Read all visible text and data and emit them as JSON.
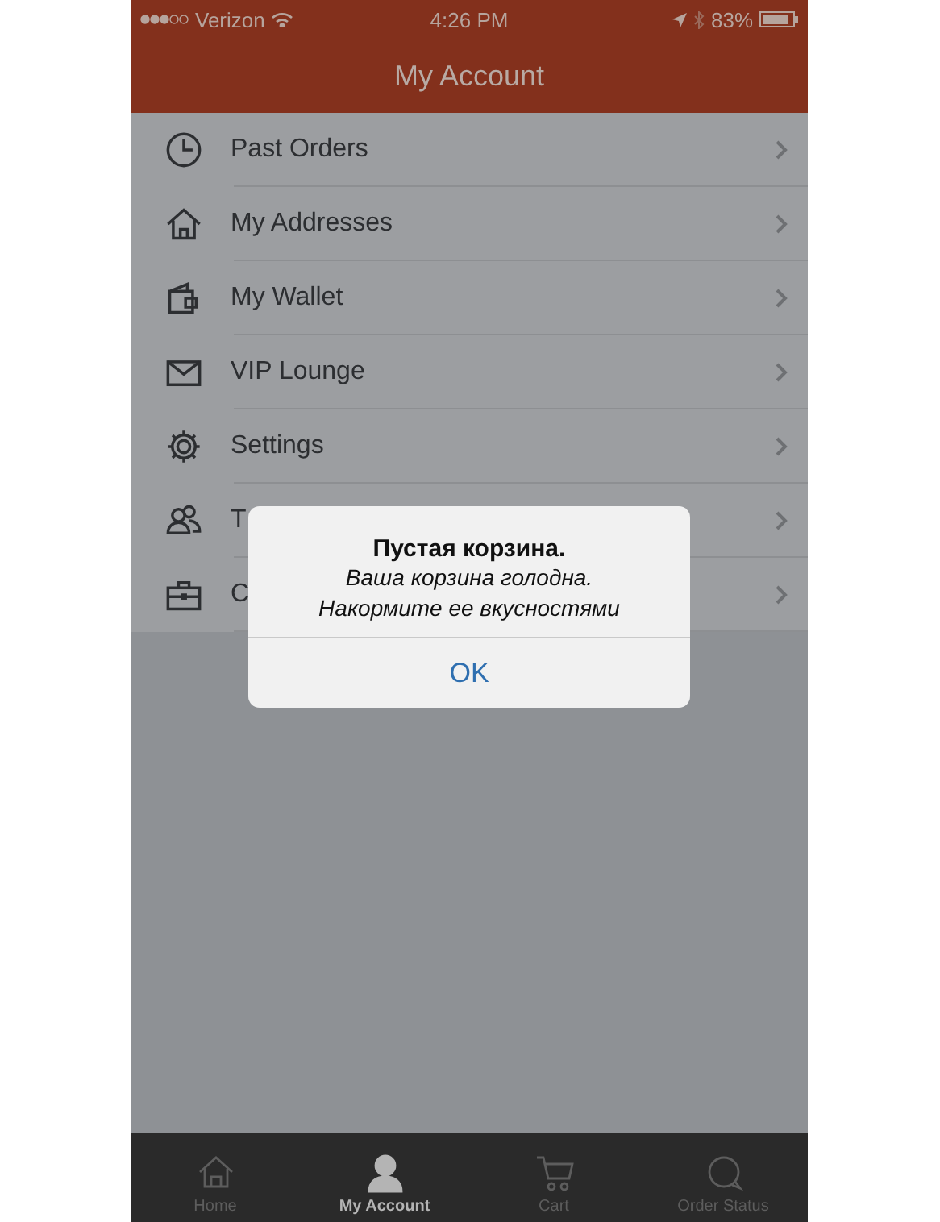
{
  "status_bar": {
    "carrier": "Verizon",
    "time": "4:26 PM",
    "battery": "83%"
  },
  "nav_bar": {
    "title": "My Account"
  },
  "menu": [
    {
      "label": "Past Orders"
    },
    {
      "label": "My Addresses"
    },
    {
      "label": "My Wallet"
    },
    {
      "label": "VIP Lounge"
    },
    {
      "label": "Settings"
    },
    {
      "label": "T"
    },
    {
      "label": "C"
    }
  ],
  "alert": {
    "title": "Пустая корзина.",
    "message_lines": [
      "Ваша корзина голодна.",
      "Накормите ее вкусностями"
    ],
    "button": "OK"
  },
  "tab_bar": [
    {
      "label": "Home",
      "selected": false
    },
    {
      "label": "My Account",
      "selected": true
    },
    {
      "label": "Cart",
      "selected": false
    },
    {
      "label": "Order Status",
      "selected": false
    }
  ]
}
